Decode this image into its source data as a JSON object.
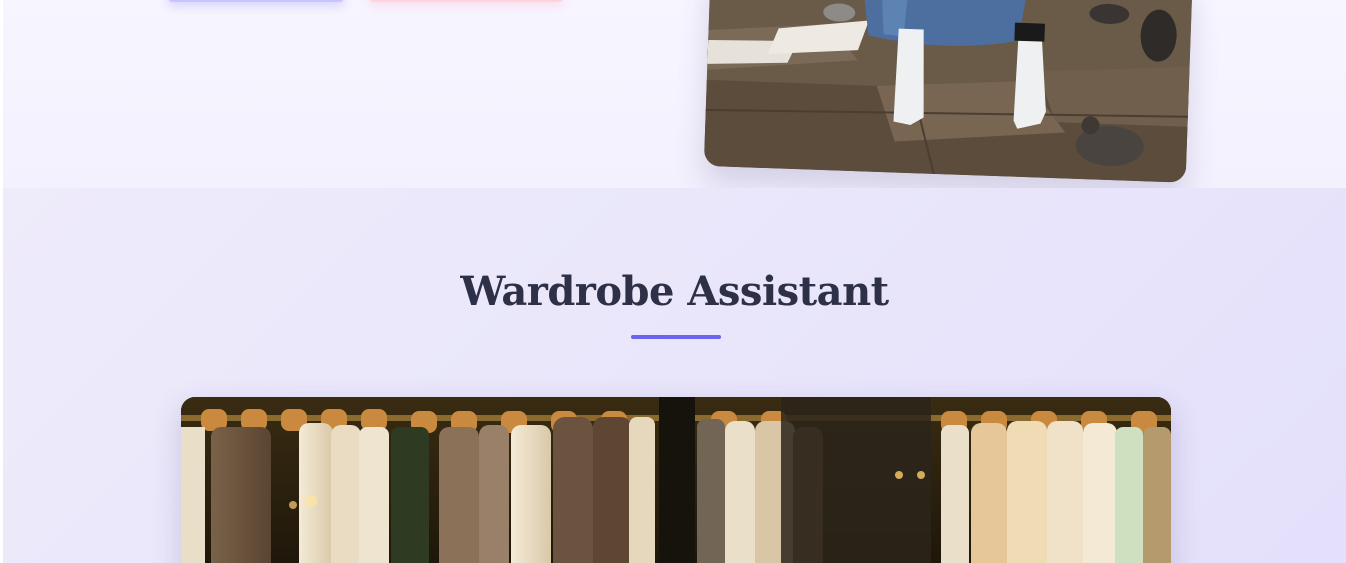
{
  "hero": {
    "primary_button_label": "",
    "secondary_button_label": ""
  },
  "wardrobe": {
    "title": "Wardrobe Assistant"
  },
  "colors": {
    "accent": "#6c63f0",
    "title_text": "#2d3047",
    "hero_background": "#f5f3fe",
    "section_background": "#ebe8fb"
  }
}
